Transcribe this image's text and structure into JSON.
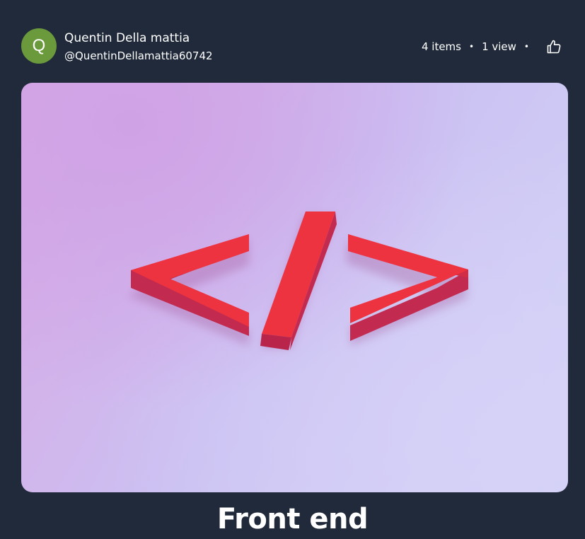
{
  "author": {
    "avatar_letter": "Q",
    "avatar_color": "#6a9a3b",
    "name": "Quentin Della mattia",
    "handle": "@QuentinDellamattia60742"
  },
  "stats": {
    "items": "4 items",
    "separator": "•",
    "views": "1 view",
    "like_icon": "thumbs-up-icon"
  },
  "cover": {
    "image": "code-brackets-icon",
    "colors": {
      "symbol": "#e8303f",
      "background": "#cbc0f2"
    }
  },
  "collection": {
    "title": "Front end"
  }
}
